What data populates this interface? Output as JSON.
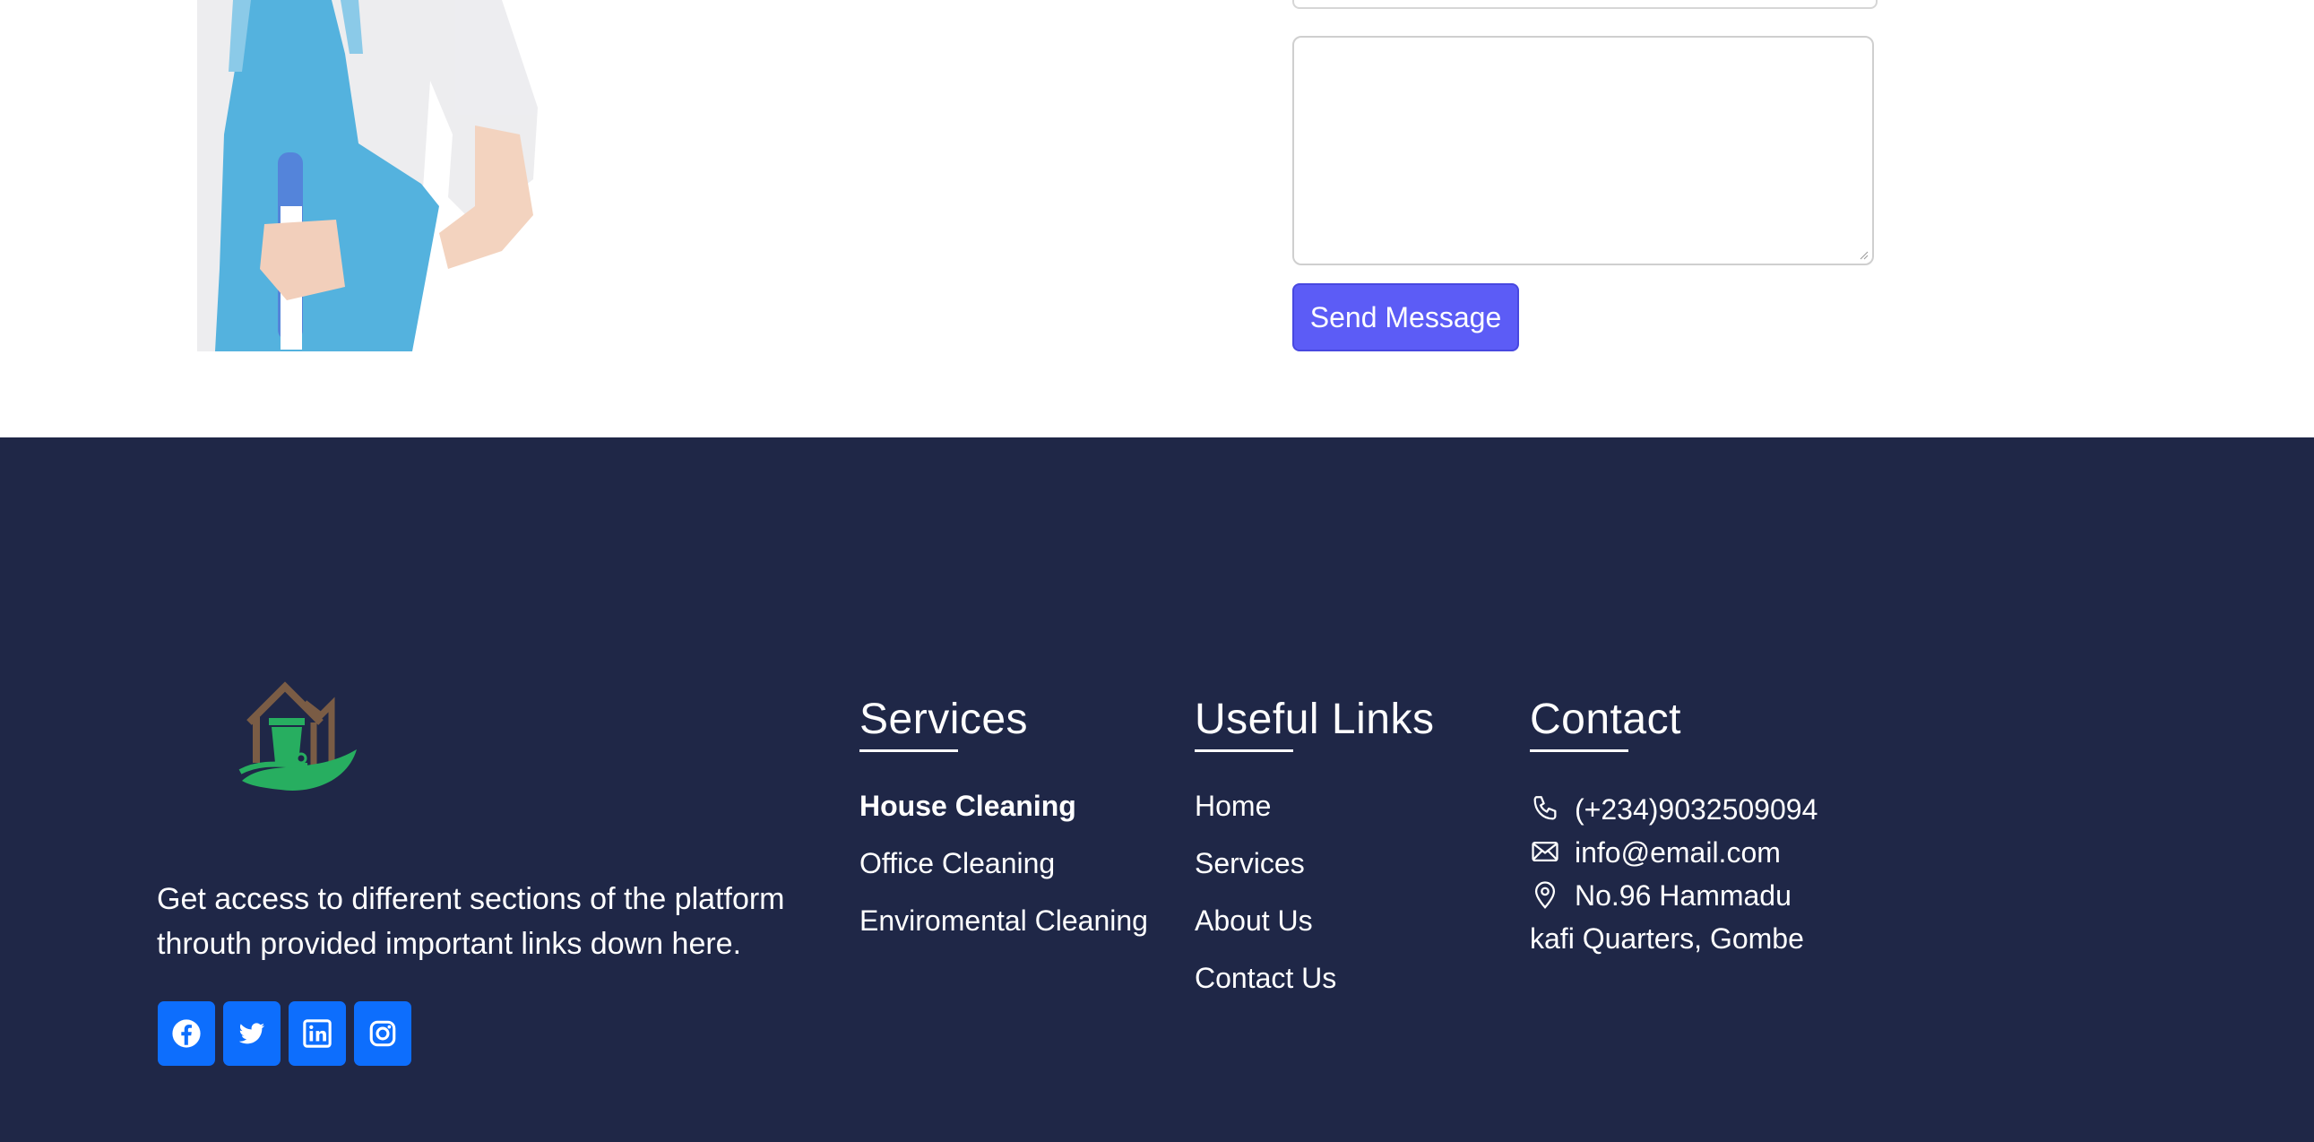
{
  "form": {
    "send_label": "Send Message"
  },
  "footer": {
    "about": "Get access to different sections of the platform throuth provided important links down here.",
    "socials": [
      {
        "icon": "facebook-icon"
      },
      {
        "icon": "twitter-icon"
      },
      {
        "icon": "linkedin-icon"
      },
      {
        "icon": "instagram-icon"
      }
    ],
    "services": {
      "title": "Services",
      "items": [
        "House Cleaning",
        "Office Cleaning",
        "Enviromental Cleaning"
      ]
    },
    "links": {
      "title": "Useful Links",
      "items": [
        "Home",
        "Services",
        "About Us",
        "Contact Us"
      ]
    },
    "contact": {
      "title": "Contact",
      "phone": "(+234)9032509094",
      "email": "info@email.com",
      "address_line1": "No.96 Hammadu",
      "address_line2": "kafi Quarters, Gombe"
    }
  },
  "colors": {
    "footer_bg": "#1f2747",
    "accent_button": "#5c5cf6",
    "social_button": "#0d6efd",
    "logo_brown": "#7a5c45",
    "logo_green": "#27ae60"
  }
}
